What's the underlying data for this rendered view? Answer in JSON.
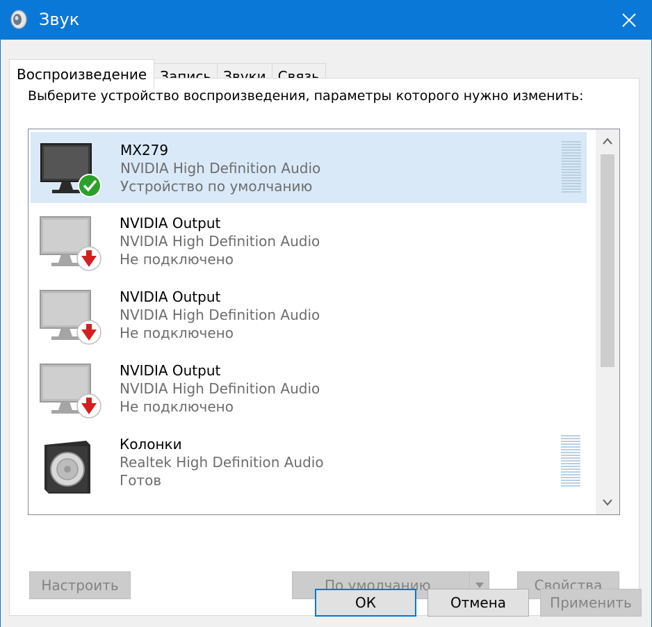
{
  "window": {
    "title": "Звук",
    "close_symbol": "✕",
    "accent_color": "#0a78d7"
  },
  "tabs": [
    {
      "label": "Воспроизведение",
      "active": true
    },
    {
      "label": "Запись",
      "active": false
    },
    {
      "label": "Звуки",
      "active": false
    },
    {
      "label": "Связь",
      "active": false
    }
  ],
  "instruction": "Выберите устройство воспроизведения, параметры которого нужно изменить:",
  "devices": [
    {
      "name": "MX279",
      "driver": "NVIDIA High Definition Audio",
      "status": "Устройство по умолчанию",
      "icon": "monitor-default-icon",
      "selected": true
    },
    {
      "name": "NVIDIA Output",
      "driver": "NVIDIA High Definition Audio",
      "status": "Не подключено",
      "icon": "monitor-disconnected-icon",
      "selected": false
    },
    {
      "name": "NVIDIA Output",
      "driver": "NVIDIA High Definition Audio",
      "status": "Не подключено",
      "icon": "monitor-disconnected-icon",
      "selected": false
    },
    {
      "name": "NVIDIA Output",
      "driver": "NVIDIA High Definition Audio",
      "status": "Не подключено",
      "icon": "monitor-disconnected-icon",
      "selected": false
    },
    {
      "name": "Колонки",
      "driver": "Realtek High Definition Audio",
      "status": "Готов",
      "icon": "speaker-icon",
      "selected": false
    }
  ],
  "buttons": {
    "configure": "Настроить",
    "set_default": "По умолчанию",
    "properties": "Свойства",
    "ok": "ОК",
    "cancel": "Отмена",
    "apply": "Применить"
  }
}
